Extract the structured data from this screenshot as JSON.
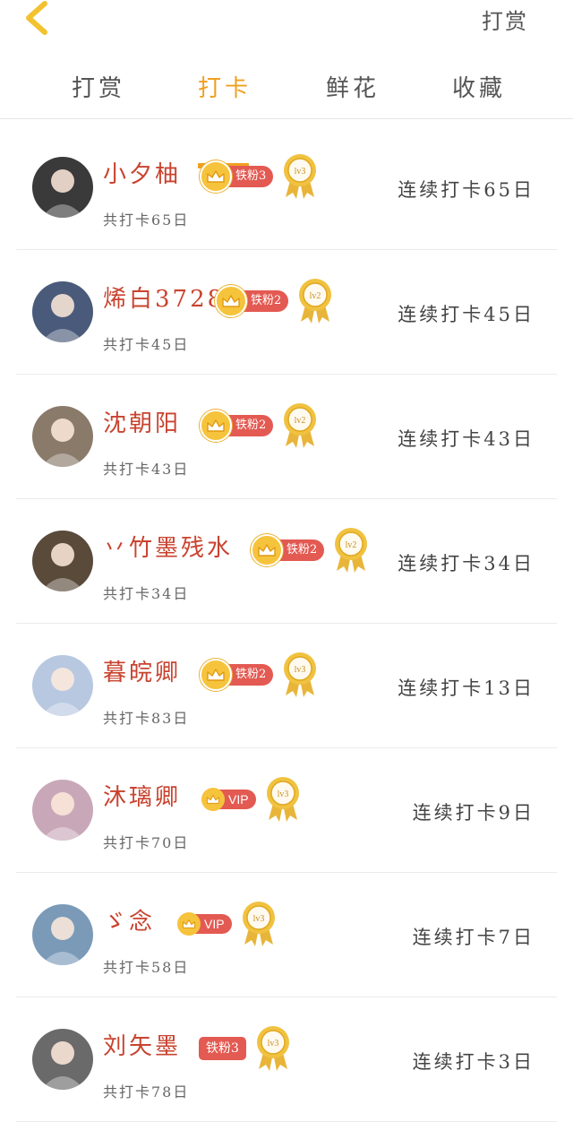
{
  "header": {
    "action_label": "打赏"
  },
  "tabs": [
    {
      "label": "打赏",
      "active": false
    },
    {
      "label": "打卡",
      "active": true
    },
    {
      "label": "鲜花",
      "active": false
    },
    {
      "label": "收藏",
      "active": false
    }
  ],
  "colors": {
    "accent": "#f0a020",
    "name": "#c9432f",
    "badge": "#e35a52",
    "crown": "#f6c33c"
  },
  "rows": [
    {
      "name": "小夕柚",
      "badge_type": "fan",
      "badge_label": "铁粉3",
      "medal": "lv3",
      "total": "共打卡65日",
      "streak": "连续打卡65日",
      "avatar_color": "#3a3a3a"
    },
    {
      "name": "烯白3728",
      "badge_type": "fan",
      "badge_label": "铁粉2",
      "medal": "lv2",
      "total": "共打卡45日",
      "streak": "连续打卡45日",
      "avatar_color": "#4a5a7a"
    },
    {
      "name": "沈朝阳",
      "badge_type": "fan",
      "badge_label": "铁粉2",
      "medal": "lv2",
      "total": "共打卡43日",
      "streak": "连续打卡43日",
      "avatar_color": "#8a7a6a"
    },
    {
      "name": "丷竹墨残水",
      "badge_type": "fan",
      "badge_label": "铁粉2",
      "medal": "lv2",
      "total": "共打卡34日",
      "streak": "连续打卡34日",
      "avatar_color": "#5a4a3a"
    },
    {
      "name": "暮皖卿",
      "badge_type": "fan",
      "badge_label": "铁粉2",
      "medal": "lv3",
      "total": "共打卡83日",
      "streak": "连续打卡13日",
      "avatar_color": "#b8c8e0"
    },
    {
      "name": "沐璃卿",
      "badge_type": "vip",
      "badge_label": "VIP",
      "medal": "lv3",
      "total": "共打卡70日",
      "streak": "连续打卡9日",
      "avatar_color": "#c8a8b8"
    },
    {
      "name": "ゞ念",
      "badge_type": "vip",
      "badge_label": "VIP",
      "medal": "lv3",
      "total": "共打卡58日",
      "streak": "连续打卡7日",
      "avatar_color": "#7a9ab8"
    },
    {
      "name": "刘矢墨",
      "badge_type": "fan_plain",
      "badge_label": "铁粉3",
      "medal": "lv3",
      "total": "共打卡78日",
      "streak": "连续打卡3日",
      "avatar_color": "#6a6a6a"
    }
  ]
}
